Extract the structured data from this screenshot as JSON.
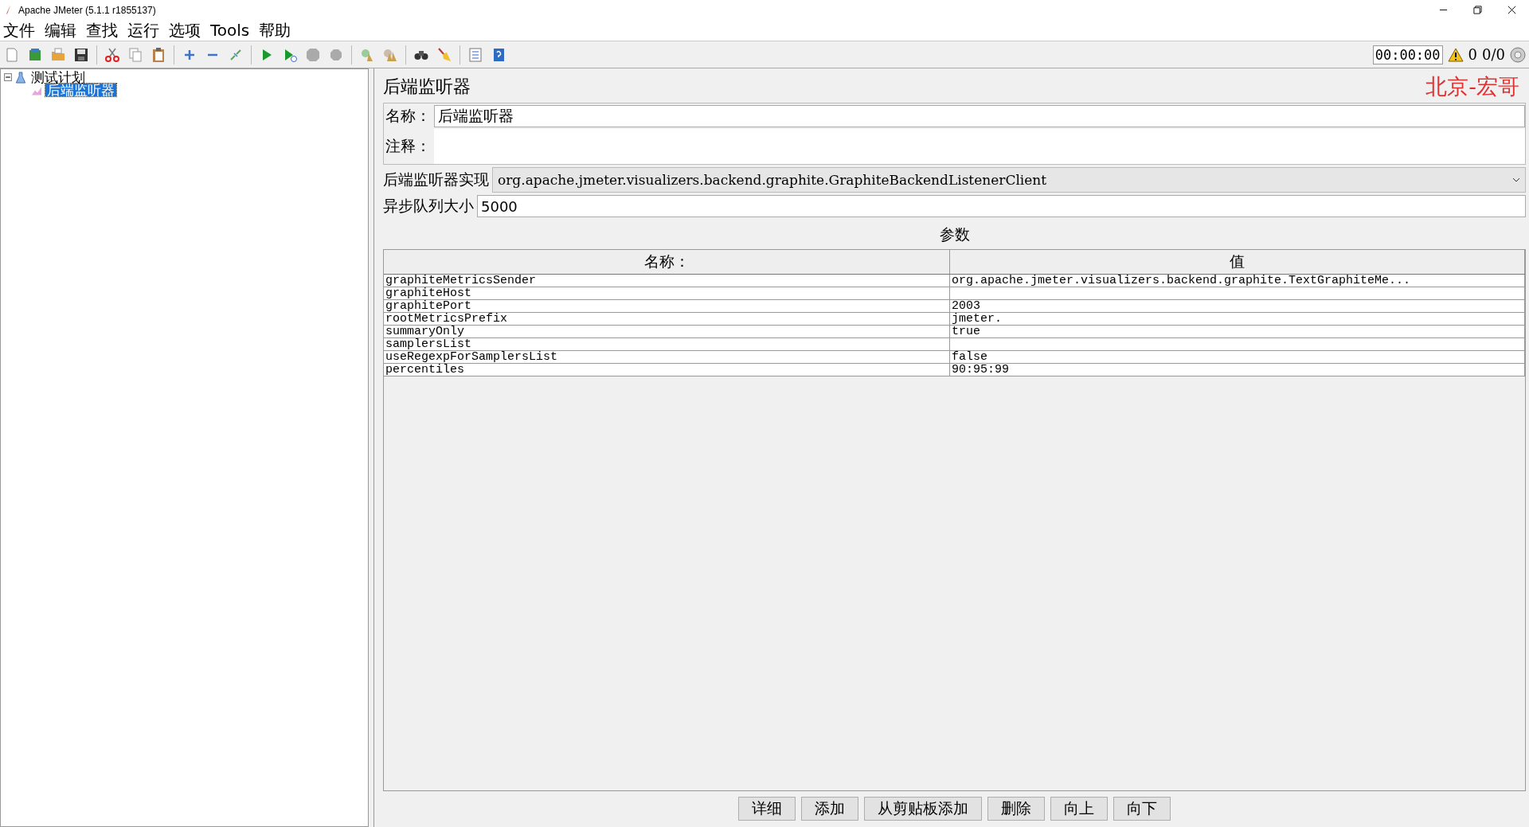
{
  "window": {
    "title": "Apache JMeter (5.1.1 r1855137)"
  },
  "menu": [
    {
      "label": "文件"
    },
    {
      "label": "编辑"
    },
    {
      "label": "查找"
    },
    {
      "label": "运行"
    },
    {
      "label": "选项"
    },
    {
      "label": "Tools"
    },
    {
      "label": "帮助"
    }
  ],
  "status": {
    "timer": "00:00:00",
    "warnings": "0",
    "threads": "0/0"
  },
  "tree": [
    {
      "label": "测试计划",
      "expanded": true,
      "selected": false,
      "children": [
        {
          "label": "后端监听器",
          "selected": true
        }
      ]
    }
  ],
  "panel": {
    "title": "后端监听器",
    "annotation": "北京-宏哥",
    "name_label": "名称：",
    "name_value": "后端监听器",
    "comment_label": "注释：",
    "impl_label": "后端监听器实现",
    "impl_value": "org.apache.jmeter.visualizers.backend.graphite.GraphiteBackendListenerClient",
    "queue_label": "异步队列大小",
    "queue_value": "5000",
    "params_title": "参数"
  },
  "table": {
    "columns": [
      "名称：",
      "值"
    ],
    "rows": [
      {
        "name": "graphiteMetricsSender",
        "value": "org.apache.jmeter.visualizers.backend.graphite.TextGraphiteMe..."
      },
      {
        "name": "graphiteHost",
        "value": ""
      },
      {
        "name": "graphitePort",
        "value": "2003"
      },
      {
        "name": "rootMetricsPrefix",
        "value": "jmeter."
      },
      {
        "name": "summaryOnly",
        "value": "true"
      },
      {
        "name": "samplersList",
        "value": ""
      },
      {
        "name": "useRegexpForSamplersList",
        "value": "false"
      },
      {
        "name": "percentiles",
        "value": "90:95:99"
      }
    ]
  },
  "buttons": [
    "详细",
    "添加",
    "从剪贴板添加",
    "删除",
    "向上",
    "向下"
  ]
}
